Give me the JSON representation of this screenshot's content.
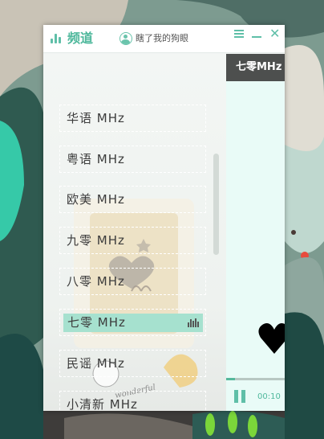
{
  "app": {
    "title": "频道",
    "user_name": "瞎了我的狗眼"
  },
  "toolbar": {
    "list_icon": "list-icon",
    "minimize_icon": "minimize-icon",
    "close_icon": "close-icon"
  },
  "channels": [
    {
      "label": "华语 MHz",
      "active": false
    },
    {
      "label": "粤语 MHz",
      "active": false
    },
    {
      "label": "欧美 MHz",
      "active": false
    },
    {
      "label": "九零 MHz",
      "active": false
    },
    {
      "label": "八零 MHz",
      "active": false
    },
    {
      "label": "七零 MHz",
      "active": true
    },
    {
      "label": "民谣 MHz",
      "active": false
    },
    {
      "label": "小清新 MHz",
      "active": false
    }
  ],
  "now_playing": {
    "channel": "七零MHz",
    "elapsed": "00:10",
    "progress": 0.15,
    "state": "playing"
  },
  "colors": {
    "accent": "#5fbfa8",
    "active_channel": "#a6e1cf",
    "header_dark": "#4d4f4e"
  }
}
